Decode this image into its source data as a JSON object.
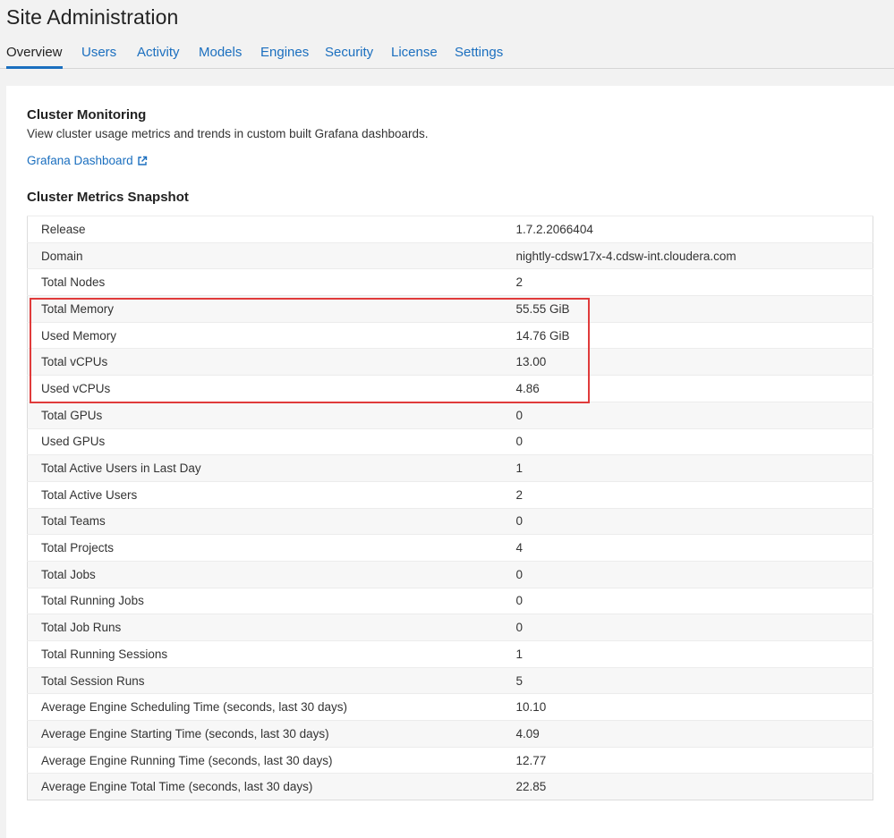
{
  "page": {
    "title": "Site Administration"
  },
  "tabs": [
    {
      "label": "Overview",
      "active": true
    },
    {
      "label": "Users"
    },
    {
      "label": "Activity"
    },
    {
      "label": "Models"
    },
    {
      "label": "Engines"
    },
    {
      "label": "Security"
    },
    {
      "label": "License"
    },
    {
      "label": "Settings"
    }
  ],
  "monitoring": {
    "title": "Cluster Monitoring",
    "description": "View cluster usage metrics and trends in custom built Grafana dashboards.",
    "link_label": "Grafana Dashboard",
    "link_icon": "external-link-icon"
  },
  "snapshot": {
    "title": "Cluster Metrics Snapshot",
    "rows": [
      {
        "label": "Release",
        "value": "1.7.2.2066404"
      },
      {
        "label": "Domain",
        "value": "nightly-cdsw17x-4.cdsw-int.cloudera.com"
      },
      {
        "label": "Total Nodes",
        "value": "2"
      },
      {
        "label": "Total Memory",
        "value": "55.55 GiB"
      },
      {
        "label": "Used Memory",
        "value": "14.76 GiB"
      },
      {
        "label": "Total vCPUs",
        "value": "13.00"
      },
      {
        "label": "Used vCPUs",
        "value": "4.86"
      },
      {
        "label": "Total GPUs",
        "value": "0"
      },
      {
        "label": "Used GPUs",
        "value": "0"
      },
      {
        "label": "Total Active Users in Last Day",
        "value": "1"
      },
      {
        "label": "Total Active Users",
        "value": "2"
      },
      {
        "label": "Total Teams",
        "value": "0"
      },
      {
        "label": "Total Projects",
        "value": "4"
      },
      {
        "label": "Total Jobs",
        "value": "0"
      },
      {
        "label": "Total Running Jobs",
        "value": "0"
      },
      {
        "label": "Total Job Runs",
        "value": "0"
      },
      {
        "label": "Total Running Sessions",
        "value": "1"
      },
      {
        "label": "Total Session Runs",
        "value": "5"
      },
      {
        "label": "Average Engine Scheduling Time (seconds, last 30 days)",
        "value": "10.10"
      },
      {
        "label": "Average Engine Starting Time (seconds, last 30 days)",
        "value": "4.09"
      },
      {
        "label": "Average Engine Running Time (seconds, last 30 days)",
        "value": "12.77"
      },
      {
        "label": "Average Engine Total Time (seconds, last 30 days)",
        "value": "22.85"
      }
    ]
  },
  "colors": {
    "accent": "#1b6fbf",
    "highlight": "#e03b3b"
  }
}
